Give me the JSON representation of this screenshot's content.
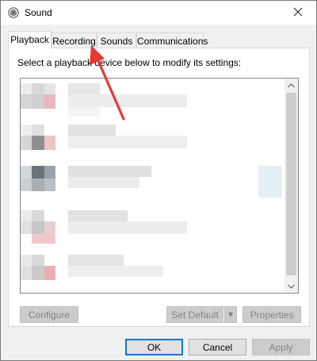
{
  "window": {
    "title": "Sound",
    "close_glyph": "✕"
  },
  "tabs": [
    {
      "label": "Playback",
      "active": true
    },
    {
      "label": "Recording",
      "active": false
    },
    {
      "label": "Sounds",
      "active": false
    },
    {
      "label": "Communications",
      "active": false
    }
  ],
  "panel": {
    "instruction": "Select a playback device below to modify its settings:",
    "device_list_state": "pixelated / obscured entries",
    "buttons": {
      "configure": "Configure",
      "set_default": "Set Default",
      "set_default_dropdown": "▾",
      "properties": "Properties"
    }
  },
  "dialog_buttons": {
    "ok": "OK",
    "cancel": "Cancel",
    "apply": "Apply"
  },
  "annotation": {
    "type": "red-arrow",
    "color": "#e53935",
    "points_to": "Recording tab"
  },
  "icons": {
    "title": "speaker-icon",
    "close": "close-icon",
    "scroll_up": "chevron-up-icon",
    "scroll_down": "chevron-down-icon"
  },
  "colors": {
    "accent": "#0078d7",
    "window_bg": "#f0f0f0",
    "panel_bg": "#ffffff"
  }
}
